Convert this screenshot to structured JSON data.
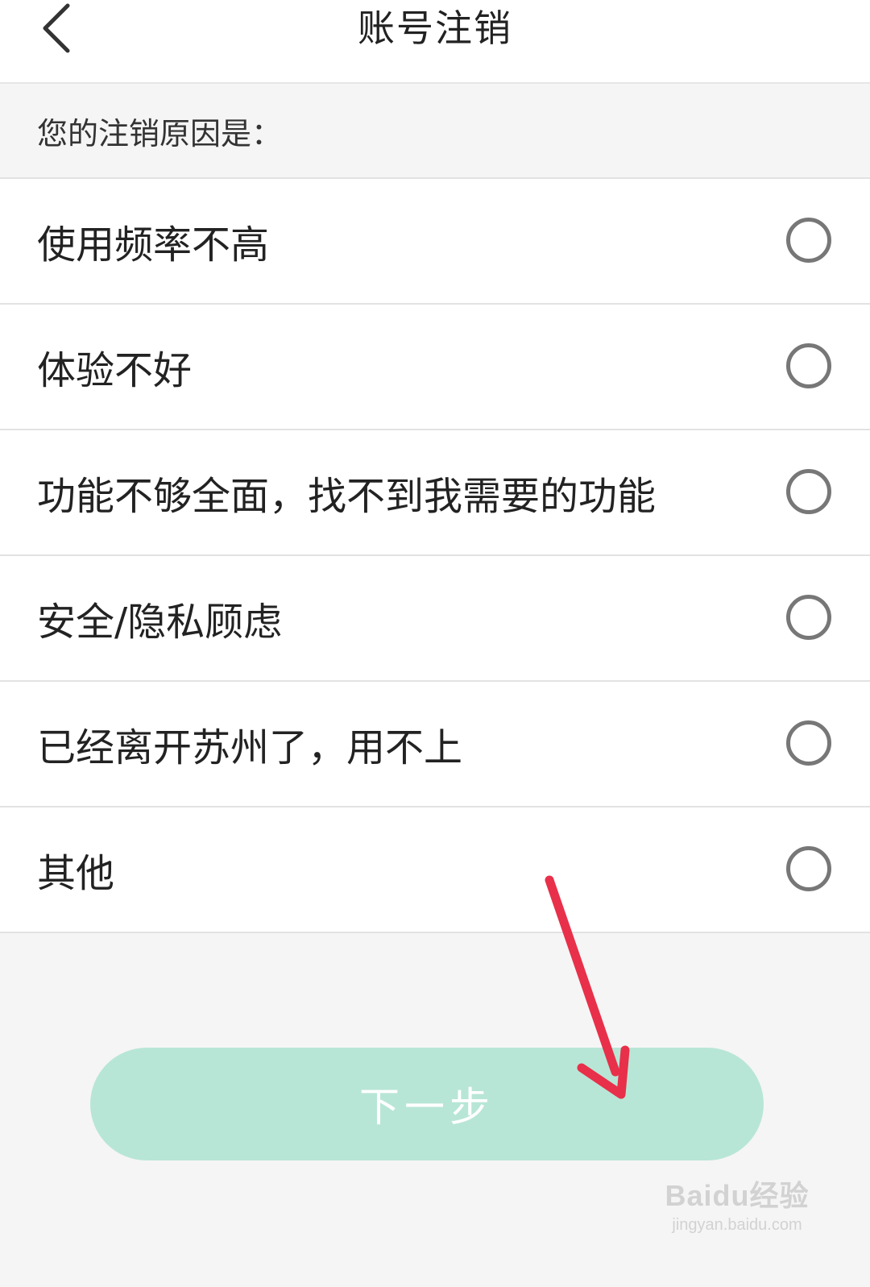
{
  "header": {
    "title": "账号注销",
    "back_icon": "chevron-left-icon"
  },
  "prompt": "您的注销原因是：",
  "reasons": [
    {
      "label": "使用频率不高",
      "selected": false
    },
    {
      "label": "体验不好",
      "selected": false
    },
    {
      "label": "功能不够全面，找不到我需要的功能",
      "selected": false
    },
    {
      "label": "安全/隐私顾虑",
      "selected": false
    },
    {
      "label": "已经离开苏州了，用不上",
      "selected": false
    },
    {
      "label": "其他",
      "selected": false
    }
  ],
  "next_button": {
    "label": "下一步",
    "color": "#b8e6d6",
    "enabled": false
  },
  "annotation": {
    "arrow_color": "#e8304a"
  },
  "watermark": {
    "main": "Baidu经验",
    "sub": "jingyan.baidu.com"
  }
}
